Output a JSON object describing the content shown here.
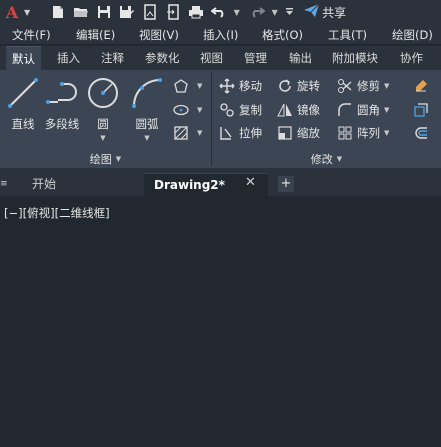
{
  "app": {
    "logo": "A",
    "share_label": "共享"
  },
  "menu": [
    "文件(F)",
    "编辑(E)",
    "视图(V)",
    "插入(I)",
    "格式(O)",
    "工具(T)",
    "绘图(D)"
  ],
  "ribbon_tabs": [
    "默认",
    "插入",
    "注释",
    "参数化",
    "视图",
    "管理",
    "输出",
    "附加模块",
    "协作"
  ],
  "active_ribbon_tab": "默认",
  "draw_panel": {
    "title": "绘图",
    "tools": {
      "line": "直线",
      "polyline": "多段线",
      "circle": "圆",
      "arc": "圆弧"
    }
  },
  "modify_panel": {
    "title": "修改",
    "tools": {
      "move": "移动",
      "rotate": "旋转",
      "trim": "修剪",
      "copy": "复制",
      "mirror": "镜像",
      "fillet": "圆角",
      "stretch": "拉伸",
      "scale": "缩放",
      "array": "阵列"
    }
  },
  "file_tabs": {
    "start": "开始",
    "drawing": "Drawing2*"
  },
  "viewport_label": "[−][俯视][二维线框]",
  "colors": {
    "accent_red": "#e0403a",
    "share_blue": "#5fa8e8",
    "ribbon_bg": "#3b4553",
    "canvas_bg": "#212830"
  }
}
